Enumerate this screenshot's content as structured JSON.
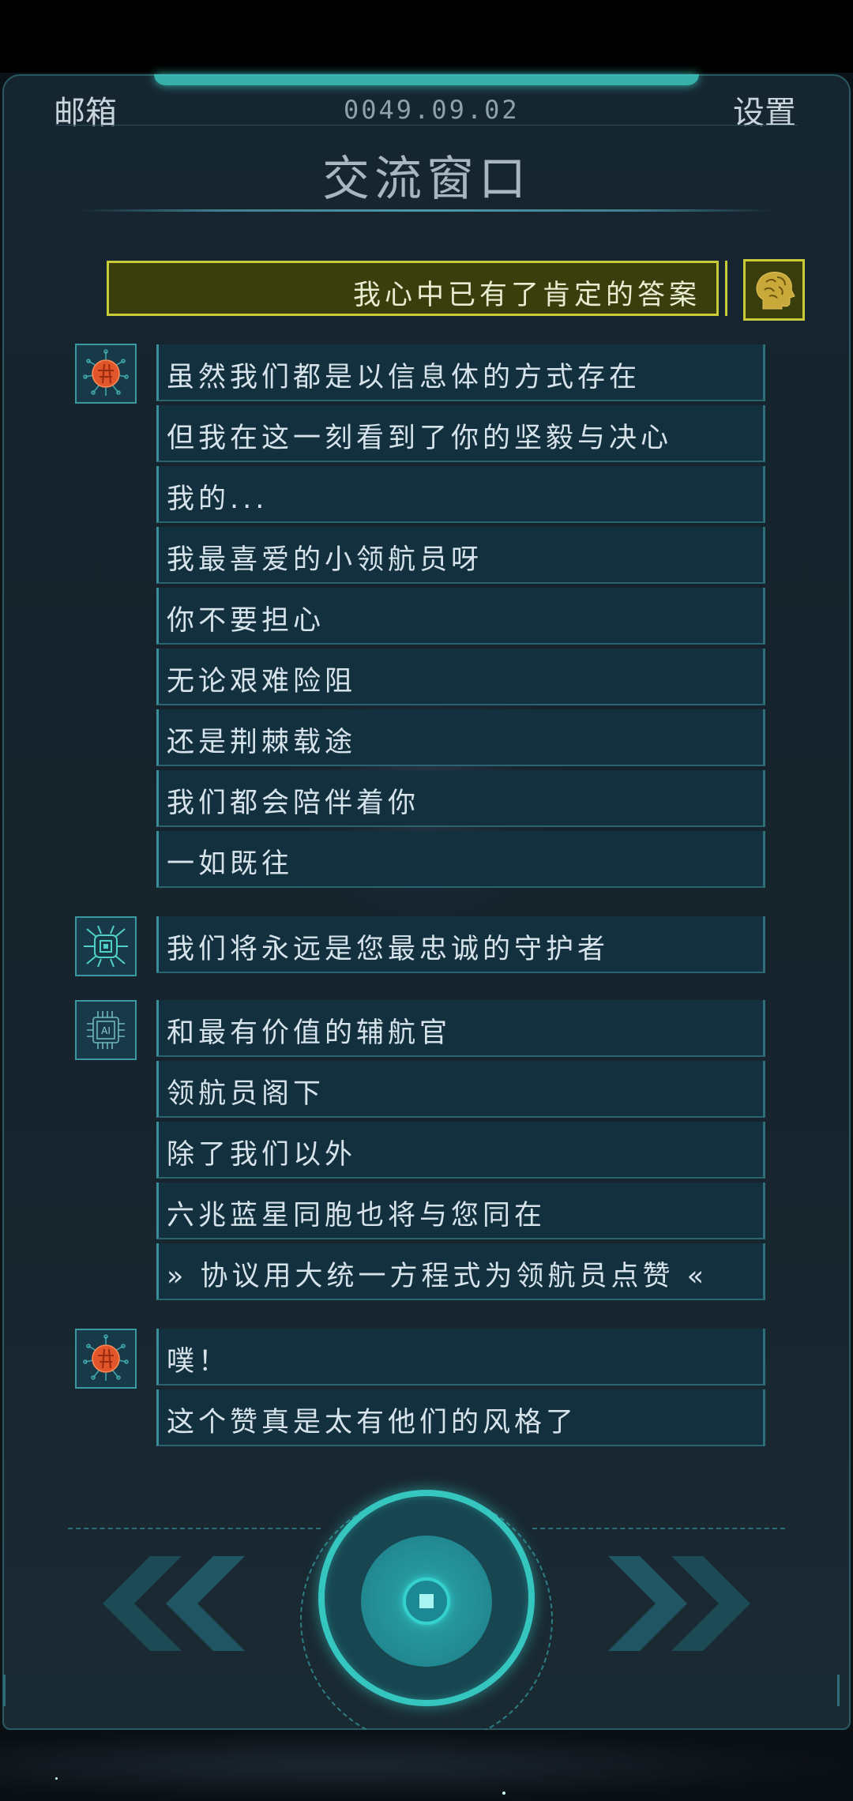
{
  "header": {
    "mailbox_label": "邮箱",
    "settings_label": "设置",
    "date": "0049.09.02",
    "title": "交流窗口"
  },
  "player_message": {
    "text": "我心中已有了肯定的答案",
    "avatar_icon": "brain-head-icon",
    "accent_color": "#c7cb38"
  },
  "groups": [
    {
      "avatar_icon": "red-core-network-icon",
      "messages": [
        "虽然我们都是以信息体的方式存在",
        "但我在这一刻看到了你的坚毅与决心",
        "我的...",
        "我最喜爱的小领航员呀",
        "你不要担心",
        "无论艰难险阻",
        "还是荆棘载途",
        "我们都会陪伴着你",
        "一如既往"
      ]
    },
    {
      "avatar_icon": "chip-bug-icon",
      "messages": [
        "我们将永远是您最忠诚的守护者"
      ]
    },
    {
      "avatar_icon": "ai-chip-icon",
      "avatar_text": "AI",
      "messages": [
        "和最有价值的辅航官",
        "领航员阁下",
        "除了我们以外",
        "六兆蓝星同胞也将与您同在",
        "» 协议用大统一方程式为领航员点赞 «"
      ]
    },
    {
      "avatar_icon": "red-core-network-icon",
      "messages": [
        "噗！",
        "这个赞真是太有他们的风格了"
      ]
    }
  ],
  "controls": {
    "prev_icon": "double-chevron-left-icon",
    "play_icon": "play-ring-icon",
    "next_icon": "double-chevron-right-icon"
  }
}
